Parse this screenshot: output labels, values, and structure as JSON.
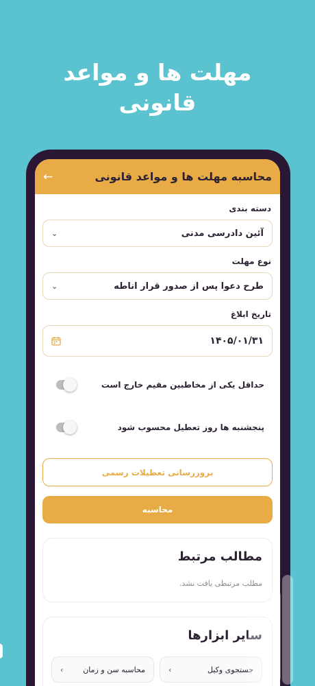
{
  "promo": {
    "line1": "مهلت ها و مواعد",
    "line2": "قانونی"
  },
  "appbar": {
    "title": "محاسبه مهلت ها و مواعد قانونی",
    "back_icon": "arrow-left-icon"
  },
  "form": {
    "category_label": "دسته بندی",
    "category_value": "آئین دادرسی مدنی",
    "deadline_type_label": "نوع مهلت",
    "deadline_type_value": "طرح دعوا پس از صدور قرار اناطه",
    "notice_date_label": "تاریخ ابلاغ",
    "notice_date_value": "۱۴۰۵/۰۱/۳۱",
    "toggle1_label": "حداقل یکی از مخاطبین مقیم خارج است",
    "toggle1_on": false,
    "toggle2_label": "پنجشنبه ها روز تعطیل محسوب شود",
    "toggle2_on": false,
    "update_holidays_button": "بروزرسانی تعطیلات رسمی",
    "calculate_button": "محاسبه"
  },
  "related": {
    "title": "مطالب مرتبط",
    "empty_text": "مطلب مرتبطی یافت نشد."
  },
  "tools": {
    "title": "سایر ابزارها",
    "items": [
      {
        "label": "جستجوی وکیل"
      },
      {
        "label": "محاسبه سن و زمان"
      }
    ]
  },
  "colors": {
    "background": "#5bc3cf",
    "accent": "#e8ab45",
    "phone_frame": "#2a1733"
  }
}
